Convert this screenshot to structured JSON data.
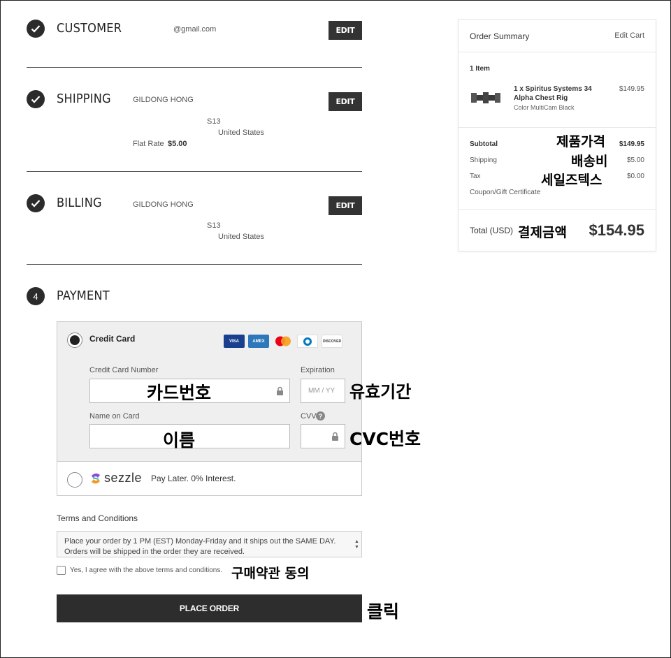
{
  "steps": {
    "customer": {
      "title": "CUSTOMER",
      "email": "@gmail.com",
      "edit_label": "EDIT"
    },
    "shipping": {
      "title": "SHIPPING",
      "name": "GILDONG HONG",
      "line1": "S13",
      "country": "United States",
      "rate_label": "Flat Rate",
      "rate_value": "$5.00",
      "edit_label": "EDIT"
    },
    "billing": {
      "title": "BILLING",
      "name": "GILDONG HONG",
      "line1": "S13",
      "country": "United States",
      "edit_label": "EDIT"
    },
    "payment": {
      "number": "4",
      "title": "PAYMENT"
    }
  },
  "payment": {
    "credit_card": {
      "label": "Credit Card",
      "cards": [
        "VISA",
        "AMEX",
        "mastercard",
        "diners",
        "DISCOVER"
      ],
      "number_label": "Credit Card Number",
      "expiration_label": "Expiration",
      "expiration_placeholder": "MM / YY",
      "name_label": "Name on Card",
      "cvv_label": "CVV"
    },
    "sezzle": {
      "brand": "sezzle",
      "tagline": "Pay Later. 0% Interest."
    }
  },
  "terms": {
    "heading": "Terms and Conditions",
    "text_line1": "Place your order by 1 PM (EST) Monday-Friday and it ships out the SAME DAY.",
    "text_line2": "Orders will be shipped in the order they are received.",
    "agree_label": "Yes, I agree with the above terms and conditions."
  },
  "place_order_label": "PLACE ORDER",
  "summary": {
    "title": "Order Summary",
    "edit_cart": "Edit Cart",
    "item_count": "1 Item",
    "item_name_line1": "1 x Spiritus Systems 34",
    "item_name_line2": "Alpha Chest Rig",
    "item_option": "Color MultiCam Black",
    "item_price": "$149.95",
    "subtotal_label": "Subtotal",
    "subtotal_value": "$149.95",
    "shipping_label": "Shipping",
    "shipping_value": "$5.00",
    "tax_label": "Tax",
    "tax_value": "$0.00",
    "coupon_label": "Coupon/Gift Certificate",
    "total_label": "Total (USD)",
    "total_value": "$154.95"
  },
  "annotations": {
    "product_price": "제품가격",
    "shipping_fee": "배송비",
    "sales_tax": "세일즈텍스",
    "payment_amount": "결제금액",
    "card_number": "카드번호",
    "expiry": "유효기간",
    "name": "이름",
    "cvc": "CVC번호",
    "agree_terms": "구매약관 동의",
    "click": "클릭"
  }
}
